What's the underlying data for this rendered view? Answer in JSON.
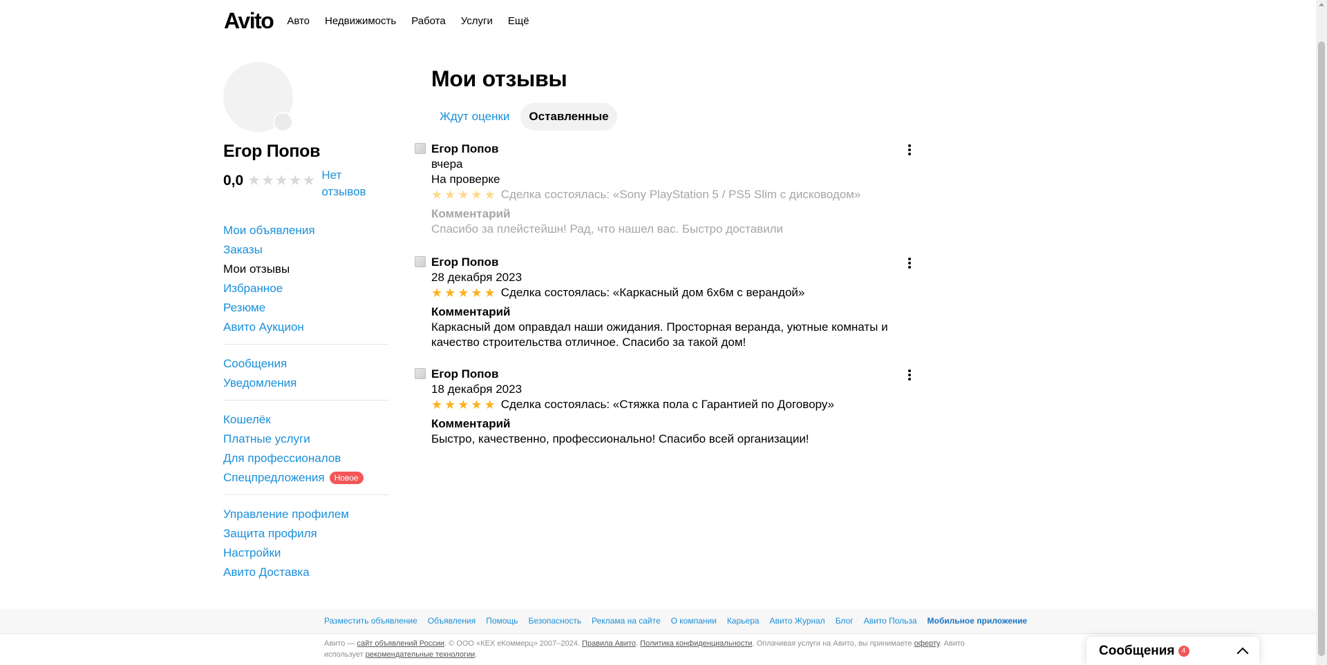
{
  "header": {
    "logo": "Avito",
    "nav": [
      "Авто",
      "Недвижимость",
      "Работа",
      "Услуги",
      "Ещё"
    ]
  },
  "sidebar": {
    "profile_name": "Егор Попов",
    "rating": "0,0",
    "no_reviews": "Нет отзывов",
    "groups": [
      [
        {
          "label": "Мои объявления"
        },
        {
          "label": "Заказы"
        },
        {
          "label": "Мои отзывы",
          "active": true
        },
        {
          "label": "Избранное"
        },
        {
          "label": "Резюме"
        },
        {
          "label": "Авито Аукцион"
        }
      ],
      [
        {
          "label": "Сообщения"
        },
        {
          "label": "Уведомления"
        }
      ],
      [
        {
          "label": "Кошелёк"
        },
        {
          "label": "Платные услуги"
        },
        {
          "label": "Для профессионалов"
        },
        {
          "label": "Спецпредложения",
          "badge": "Новое"
        }
      ],
      [
        {
          "label": "Управление профилем"
        },
        {
          "label": "Защита профиля"
        },
        {
          "label": "Настройки"
        },
        {
          "label": "Авито Доставка"
        }
      ]
    ]
  },
  "main": {
    "title": "Мои отзывы",
    "tabs": {
      "pending": "Ждут оценки",
      "left": "Оставленные"
    },
    "reviews": [
      {
        "author": "Егор Попов",
        "date": "вчера",
        "status": "На проверке",
        "rating": 5,
        "deal": "Сделка состоялась: «Sony PlayStation 5 / PS5 Slim с дисководом»",
        "comment_label": "Комментарий",
        "comment": "Спасибо за плейстейшн! Рад, что нашел вас. Быстро доставили"
      },
      {
        "author": "Егор Попов",
        "date": "28 декабря 2023",
        "rating": 5,
        "deal": "Сделка состоялась: «Каркасный дом 6х6м с верандой»",
        "comment_label": "Комментарий",
        "comment": "Каркасный дом оправдал наши ожидания. Просторная веранда, уютные комнаты и качество строительства отличное. Спасибо за такой дом!"
      },
      {
        "author": "Егор Попов",
        "date": "18 декабря 2023",
        "rating": 5,
        "deal": "Сделка состоялась: «Стяжка пола с Гарантией по Договору»",
        "comment_label": "Комментарий",
        "comment": "Быстро, качественно, профессионально! Спасибо всей организации!"
      }
    ]
  },
  "footer": {
    "links": [
      "Разместить объявление",
      "Объявления",
      "Помощь",
      "Безопасность",
      "Реклама на сайте",
      "О компании",
      "Карьера",
      "Авито Журнал",
      "Блог",
      "Авито Польза",
      "Мобильное приложение"
    ],
    "legal": {
      "p1": "Авито — ",
      "l1": "сайт объявлений России",
      "p2": ". © ООО «КЕХ еКоммерц» 2007–2024. ",
      "l2": "Правила Авито",
      "p3": ". ",
      "l3": "Политика конфиденциальности",
      "p4": ". Оплачивая услуги на Авито, вы принимаете ",
      "l4": "оферту",
      "p5": ". Авито использует ",
      "l5": "рекомендательные технологии",
      "p6": "."
    }
  },
  "messages_widget": {
    "title": "Сообщения",
    "count": "4"
  }
}
